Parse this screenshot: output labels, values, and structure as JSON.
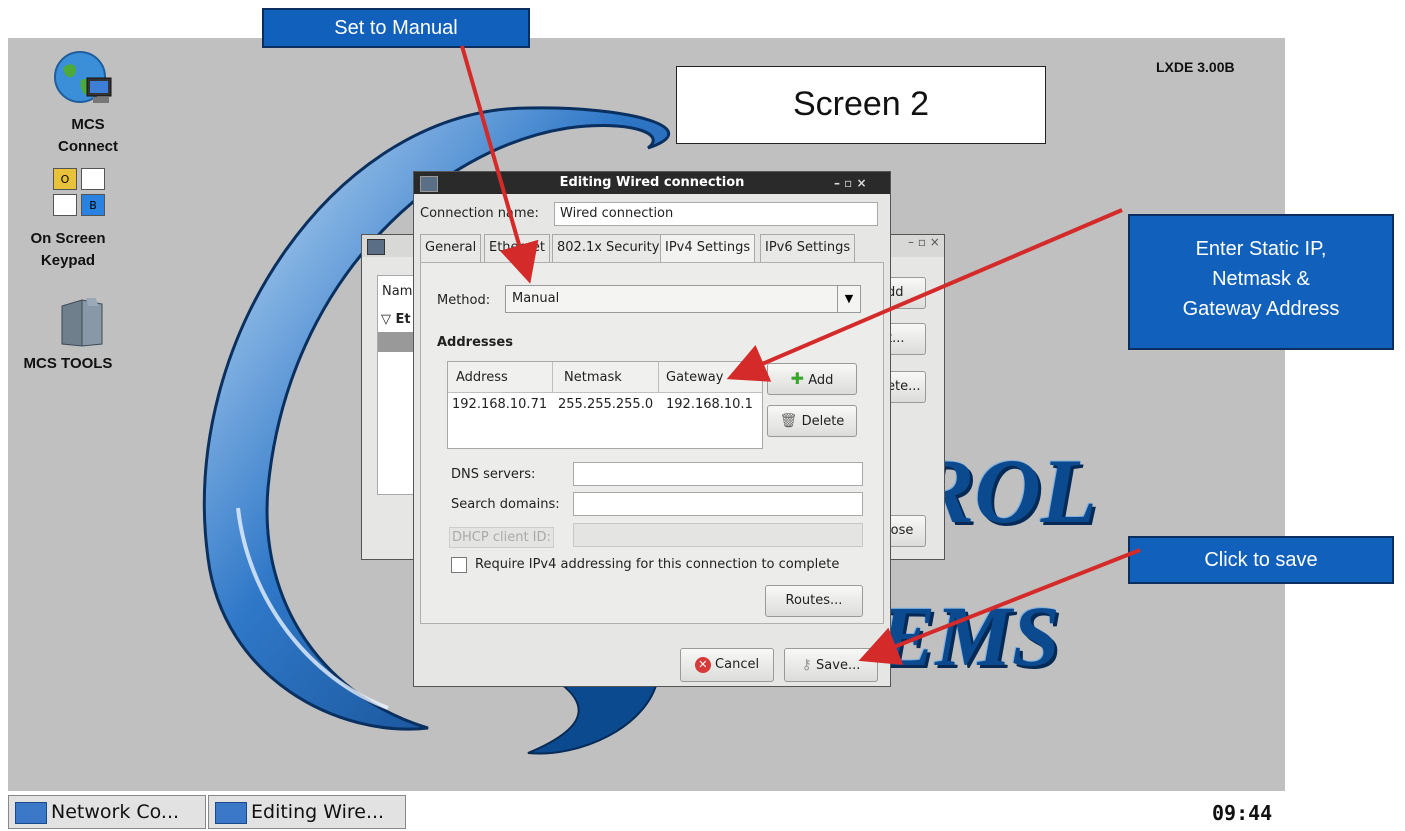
{
  "desktop": {
    "version": "LXDE 3.00B",
    "icons": [
      {
        "label_line1": "MCS",
        "label_line2": "Connect",
        "icon": "globe-computer-icon"
      },
      {
        "label_line1": "On Screen",
        "label_line2": "Keypad",
        "icon": "keypad-icon",
        "key1": "O",
        "key2": "B"
      },
      {
        "label_line1": "MCS TOOLS",
        "label_line2": "",
        "icon": "folder-icon"
      }
    ],
    "logo": {
      "word1": "ROL",
      "word2": "EMS",
      "letter": "S"
    }
  },
  "screen_label": "Screen 2",
  "bg_window": {
    "col_name": "Nam",
    "tree_item": "Et",
    "btn_add": "dd",
    "btn_edit": "t...",
    "btn_delete": "ete...",
    "btn_close": "lose"
  },
  "dialog": {
    "title": "Editing Wired connection",
    "connection_name_label": "Connection name:",
    "connection_name": "Wired connection",
    "tabs": [
      "General",
      "Ethernet",
      "802.1x Security",
      "IPv4 Settings",
      "IPv6 Settings"
    ],
    "active_tab": "IPv4 Settings",
    "method_label": "Method:",
    "method_value": "Manual",
    "addresses_heading": "Addresses",
    "table": {
      "headers": [
        "Address",
        "Netmask",
        "Gateway"
      ],
      "rows": [
        [
          "192.168.10.71",
          "255.255.255.0",
          "192.168.10.1"
        ]
      ]
    },
    "add_label": "Add",
    "delete_label": "Delete",
    "dns_label": "DNS servers:",
    "dns_value": "",
    "search_label": "Search domains:",
    "search_value": "",
    "dhcp_label": "DHCP client ID:",
    "dhcp_value": "",
    "require_label": "Require IPv4 addressing for this connection to complete",
    "require_checked": false,
    "routes_label": "Routes...",
    "cancel_label": "Cancel",
    "save_label": "Save..."
  },
  "callouts": {
    "manual": "Set to Manual",
    "static_line1": "Enter Static IP,",
    "static_line2": "Netmask &",
    "static_line3": "Gateway Address",
    "save": "Click to save"
  },
  "taskbar": {
    "items": [
      "Network Co...",
      "Editing Wire..."
    ],
    "clock": "09:44"
  },
  "colors": {
    "desktop_bg": "#c0c0c0",
    "callout_bg": "#1160bb",
    "arrow": "#d42a2a",
    "titlebar": "#2a2a2a"
  }
}
